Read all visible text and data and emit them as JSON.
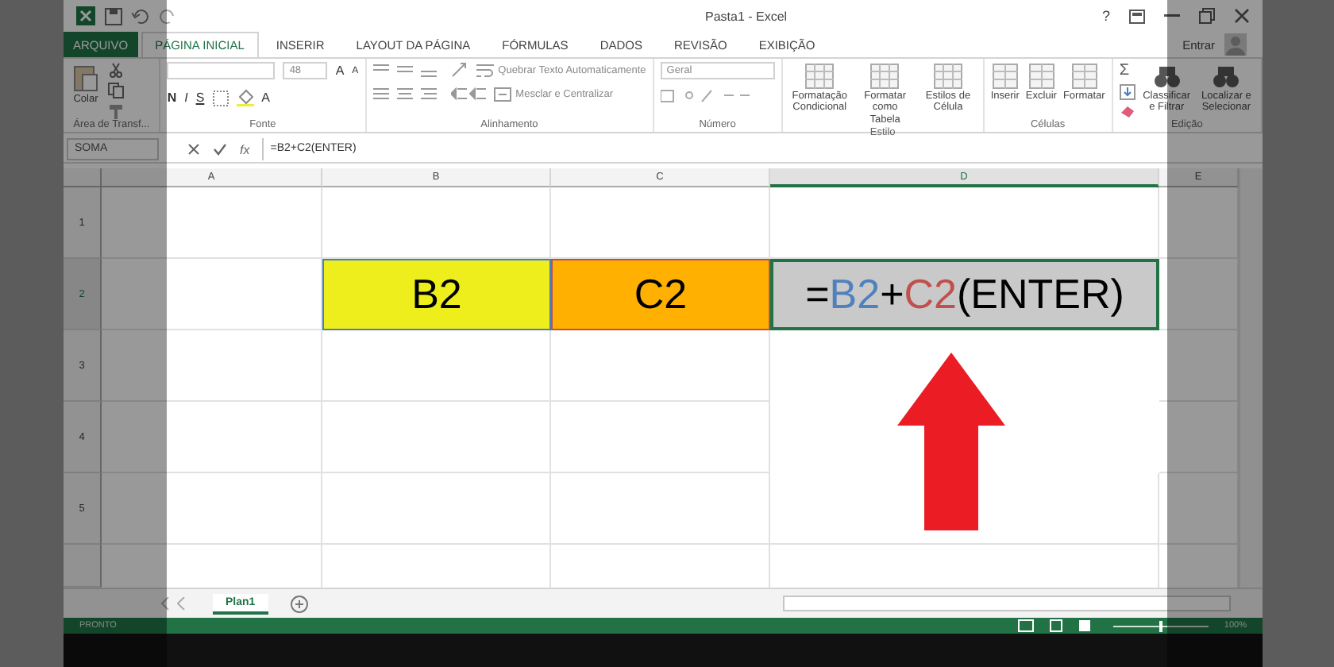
{
  "window": {
    "title": "Pasta1 - Excel",
    "help": "?",
    "account": "Entrar"
  },
  "tabs": [
    {
      "label": "ARQUIVO",
      "kind": "file",
      "selected": false
    },
    {
      "label": "PÁGINA INICIAL",
      "kind": "tab",
      "selected": true
    },
    {
      "label": "INSERIR",
      "kind": "tab",
      "selected": false
    },
    {
      "label": "LAYOUT DA PÁGINA",
      "kind": "tab",
      "selected": false
    },
    {
      "label": "FÓRMULAS",
      "kind": "tab",
      "selected": false
    },
    {
      "label": "DADOS",
      "kind": "tab",
      "selected": false
    },
    {
      "label": "REVISÃO",
      "kind": "tab",
      "selected": false
    },
    {
      "label": "EXIBIÇÃO",
      "kind": "tab",
      "selected": false
    }
  ],
  "ribbon": {
    "clipboard": {
      "label": "Área de Transf...",
      "paste": "Colar"
    },
    "font": {
      "label": "Fonte",
      "size": "48",
      "grow": "A",
      "shrink": "A",
      "bold": "N",
      "italic": "I",
      "underline": "S",
      "font_color": "A"
    },
    "alignment": {
      "label": "Alinhamento",
      "wrap": "Quebrar Texto Automaticamente",
      "merge": "Mesclar e Centralizar"
    },
    "number": {
      "label": "Número",
      "format": "Geral"
    },
    "styles": {
      "label": "Estilo",
      "buttons": [
        "Formatação Condicional",
        "Formatar como Tabela",
        "Estilos de Célula"
      ]
    },
    "cells": {
      "label": "Células",
      "buttons": [
        "Inserir",
        "Excluir",
        "Formatar"
      ]
    },
    "editing": {
      "label": "Edição",
      "autosum": "Σ",
      "buttons": [
        "Classificar e Filtrar",
        "Localizar e Selecionar"
      ]
    }
  },
  "formula_bar": {
    "name_box": "SOMA",
    "function_label": "fx",
    "formula": "=B2+C2(ENTER)"
  },
  "columns": [
    {
      "label": "A",
      "selected": false
    },
    {
      "label": "B",
      "selected": false
    },
    {
      "label": "C",
      "selected": false
    },
    {
      "label": "D",
      "selected": true
    },
    {
      "label": "E",
      "selected": false
    }
  ],
  "rows": [
    {
      "label": "1",
      "selected": false
    },
    {
      "label": "2",
      "selected": true,
      "cells": {
        "B": {
          "color": "#eeee1c",
          "highlight": {
            "color": "#4a7ebb"
          },
          "selected": false,
          "text": "B2"
        },
        "C": {
          "color": "#ffb000",
          "highlight": {
            "color": "#c0504d"
          },
          "selected": false,
          "text": "C2"
        },
        "D": {
          "color": "#c9c9c9",
          "selected": true,
          "parts": [
            {
              "text": "=",
              "color": "#000000"
            },
            {
              "text": "B2",
              "color": "#4f81bd"
            },
            {
              "text": "+",
              "color": "#000000"
            },
            {
              "text": "C2",
              "color": "#c0504d"
            },
            {
              "text": "(ENTER)",
              "color": "#000000"
            }
          ]
        }
      }
    },
    {
      "label": "3",
      "selected": false
    },
    {
      "label": "4",
      "selected": false
    },
    {
      "label": "5",
      "selected": false
    }
  ],
  "sheet_tabs": [
    {
      "label": "Plan1",
      "selected": true
    }
  ],
  "status_bar": {
    "status": "PRONTO",
    "zoom_slider": {
      "level": 0.5
    },
    "zoom": "100%"
  }
}
